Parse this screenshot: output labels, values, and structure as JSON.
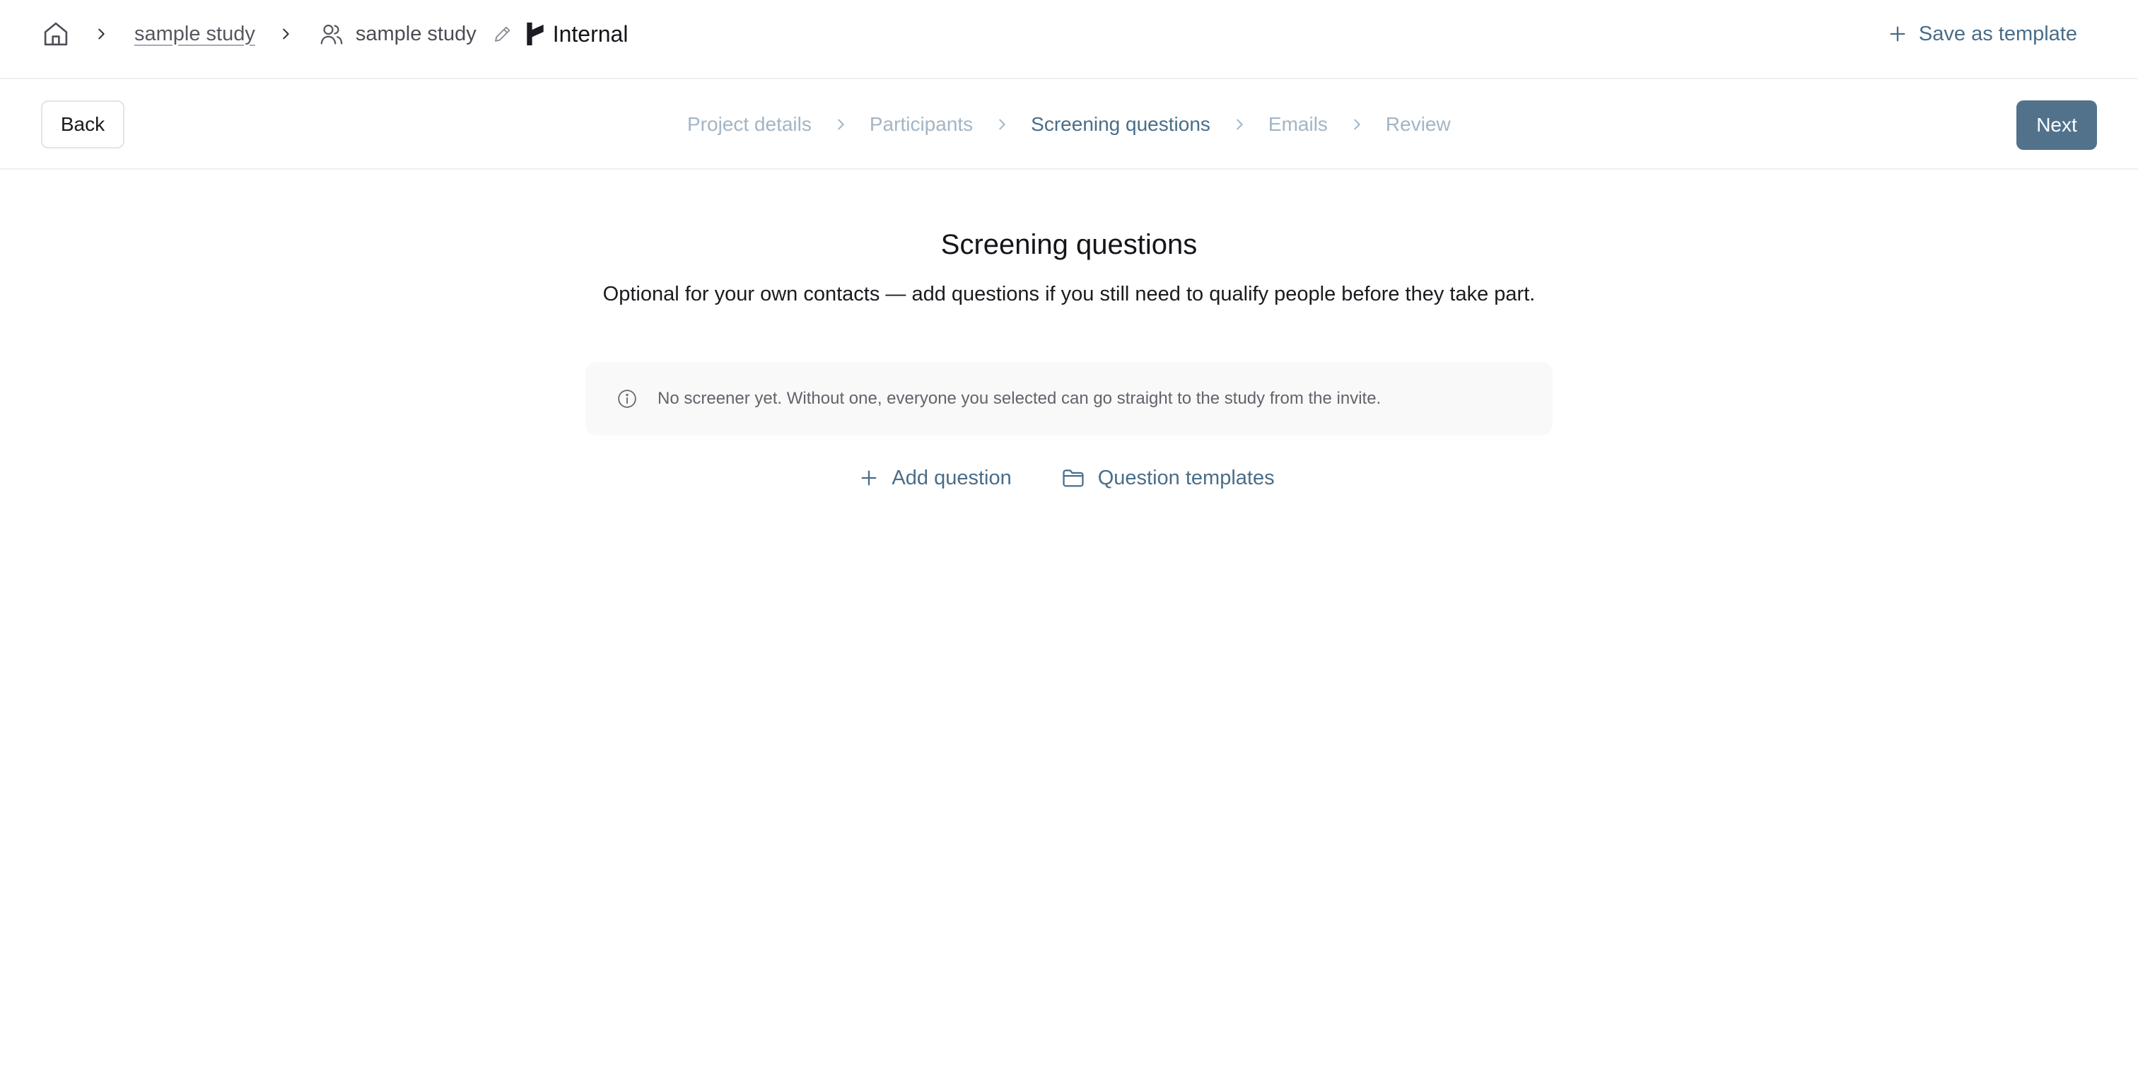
{
  "header": {
    "breadcrumb": {
      "home_icon": "home-icon",
      "study_link": "sample study",
      "participant_group": "sample study",
      "brand_label": "Internal"
    },
    "save_template_label": "Save as template"
  },
  "stepper": {
    "back_label": "Back",
    "next_label": "Next",
    "steps": [
      {
        "label": "Project details",
        "state": "inactive"
      },
      {
        "label": "Participants",
        "state": "inactive"
      },
      {
        "label": "Screening questions",
        "state": "active"
      },
      {
        "label": "Emails",
        "state": "inactive"
      },
      {
        "label": "Review",
        "state": "inactive"
      }
    ]
  },
  "main": {
    "title": "Screening questions",
    "subtitle": "Optional for your own contacts — add questions if you still need to qualify people before they take part.",
    "notice": "No screener yet. Without one, everyone you selected can go straight to the study from the invite.",
    "add_question_label": "Add question",
    "question_templates_label": "Question templates"
  },
  "colors": {
    "accent": "#4a6d88",
    "primary_button": "#52728c",
    "inactive_step": "#a3b5c4",
    "notice_background": "#f9f9fa"
  }
}
